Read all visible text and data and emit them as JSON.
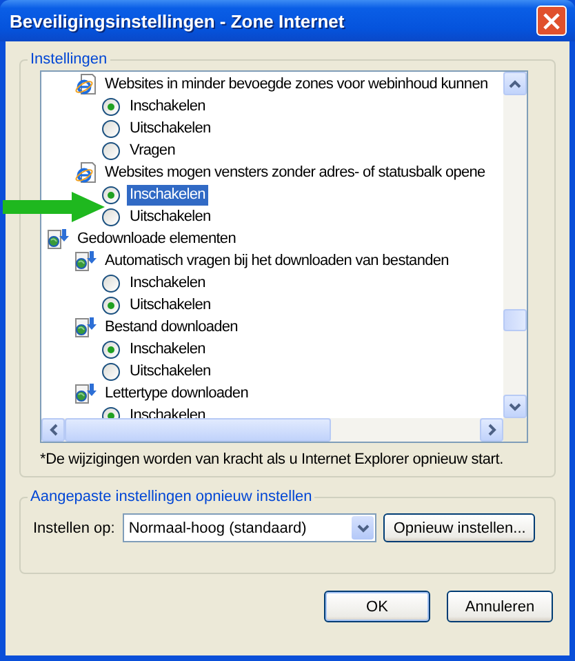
{
  "window": {
    "title": "Beveiligingsinstellingen - Zone Internet"
  },
  "settings_group": {
    "title": "Instellingen",
    "tree": [
      {
        "kind": "continued",
        "children": [
          {
            "kind": "browser-setting",
            "label": "Websites in minder bevoegde zones voor webinhoud kunnen",
            "children": [
              {
                "kind": "option",
                "label": "Inschakelen",
                "selected": true,
                "highlighted": false
              },
              {
                "kind": "option",
                "label": "Uitschakelen",
                "selected": false,
                "highlighted": false
              },
              {
                "kind": "option",
                "label": "Vragen",
                "selected": false,
                "highlighted": false
              }
            ]
          },
          {
            "kind": "browser-setting",
            "label": "Websites mogen vensters zonder adres- of statusbalk opene",
            "children": [
              {
                "kind": "option",
                "label": "Inschakelen",
                "selected": true,
                "highlighted": true
              },
              {
                "kind": "option",
                "label": "Uitschakelen",
                "selected": false,
                "highlighted": false
              }
            ]
          }
        ]
      },
      {
        "kind": "download-category",
        "label": "Gedownloade elementen",
        "children": [
          {
            "kind": "download-setting",
            "label": "Automatisch vragen bij het downloaden van bestanden",
            "children": [
              {
                "kind": "option",
                "label": "Inschakelen",
                "selected": false,
                "highlighted": false
              },
              {
                "kind": "option",
                "label": "Uitschakelen",
                "selected": true,
                "highlighted": false
              }
            ]
          },
          {
            "kind": "download-setting",
            "label": "Bestand downloaden",
            "children": [
              {
                "kind": "option",
                "label": "Inschakelen",
                "selected": true,
                "highlighted": false
              },
              {
                "kind": "option",
                "label": "Uitschakelen",
                "selected": false,
                "highlighted": false
              }
            ]
          },
          {
            "kind": "download-setting",
            "label": "Lettertype downloaden",
            "children": [
              {
                "kind": "option",
                "label": "Inschakelen",
                "selected": true,
                "highlighted": false
              }
            ]
          }
        ]
      }
    ],
    "note": "*De wijzigingen worden van kracht als u Internet Explorer opnieuw start."
  },
  "reset_group": {
    "title": "Aangepaste instellingen opnieuw instellen",
    "label": "Instellen op:",
    "dropdown": {
      "value": "Normaal-hoog (standaard)"
    },
    "button": "Opnieuw instellen..."
  },
  "buttons": [
    "OK",
    "Annuleren"
  ]
}
